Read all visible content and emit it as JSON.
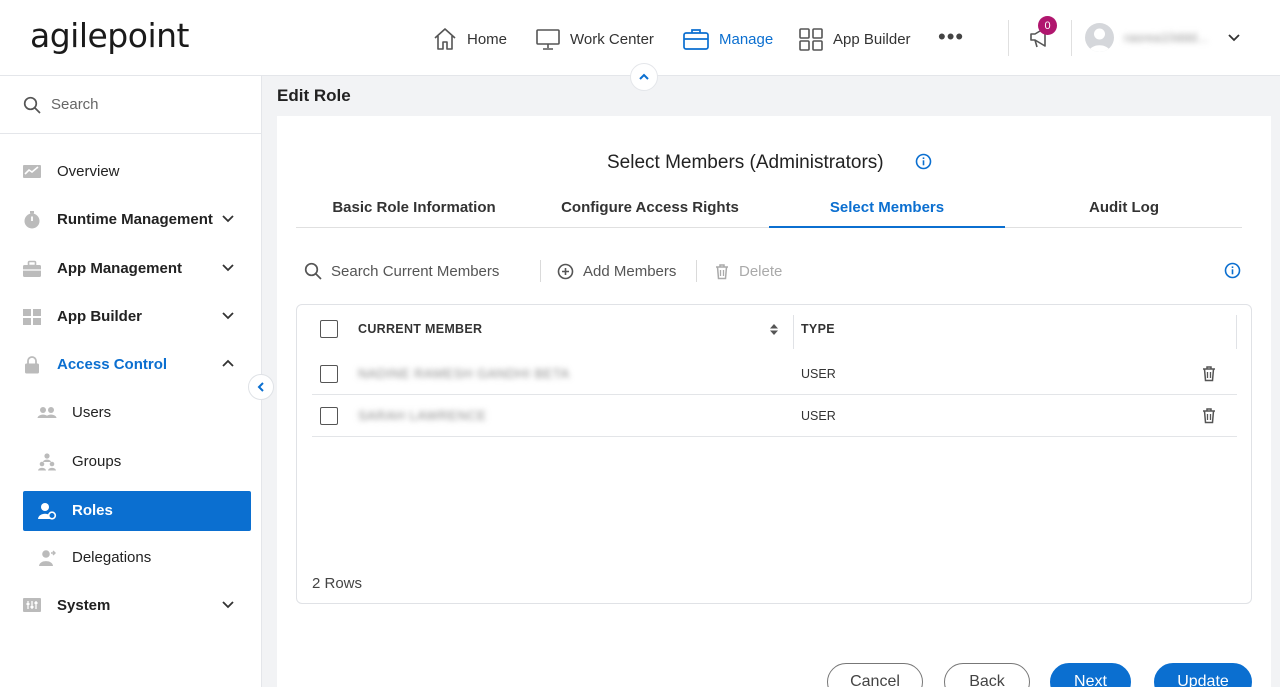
{
  "header": {
    "logo_text": "agilepoint",
    "nav": [
      {
        "label": "Home",
        "icon": "home-icon"
      },
      {
        "label": "Work Center",
        "icon": "monitor-icon"
      },
      {
        "label": "Manage",
        "icon": "briefcase-icon",
        "active": true
      },
      {
        "label": "App Builder",
        "icon": "grid-icon"
      }
    ],
    "more_label": "•••",
    "notification_count": "0",
    "username": "rasrea10ddd..."
  },
  "sidebar": {
    "search_label": "Search",
    "items": [
      {
        "label": "Overview"
      },
      {
        "label": "Runtime Management"
      },
      {
        "label": "App Management"
      },
      {
        "label": "App Builder"
      },
      {
        "label": "Access Control"
      },
      {
        "label": "Users"
      },
      {
        "label": "Groups"
      },
      {
        "label": "Roles"
      },
      {
        "label": "Delegations"
      },
      {
        "label": "System"
      }
    ]
  },
  "main": {
    "page_title": "Edit Role",
    "card_title": "Select Members (Administrators)",
    "tabs": [
      {
        "label": "Basic Role Information"
      },
      {
        "label": "Configure Access Rights"
      },
      {
        "label": "Select Members"
      },
      {
        "label": "Audit Log"
      }
    ],
    "toolbar": {
      "search_label": "Search Current Members",
      "add_label": "Add Members",
      "delete_label": "Delete"
    },
    "grid": {
      "columns": [
        "CURRENT MEMBER",
        "TYPE"
      ],
      "rows": [
        {
          "name": "NADINE RAMESH GANDHI BETA",
          "type": "USER"
        },
        {
          "name": "SARAH LAWRENCE",
          "type": "USER"
        }
      ],
      "row_count": "2 Rows"
    },
    "buttons": {
      "cancel": "Cancel",
      "back": "Back",
      "next": "Next",
      "update": "Update"
    }
  },
  "colors": {
    "accent": "#0b6fd0",
    "badge": "#b0166e"
  }
}
